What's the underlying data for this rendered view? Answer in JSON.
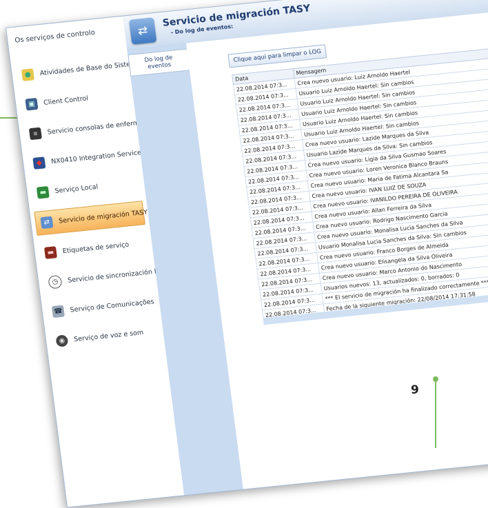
{
  "sidebar": {
    "title": "Os serviços de controlo",
    "items": [
      {
        "label": "Atividades de Base do Sistema",
        "icon": "users-icon"
      },
      {
        "label": "Client Control",
        "icon": "monitor-icon"
      },
      {
        "label": "Servicio consolas de enfermera",
        "icon": "console-icon"
      },
      {
        "label": "NX0410 Integration Service",
        "icon": "integration-icon"
      },
      {
        "label": "Serviço Local",
        "icon": "book-icon"
      },
      {
        "label": "Servicio de migración TASY",
        "icon": "migration-icon"
      },
      {
        "label": "Etiquetas de serviço",
        "icon": "label-icon"
      },
      {
        "label": "Servicio de sincronización horaria",
        "icon": "clock-icon"
      },
      {
        "label": "Serviço de Comunicações",
        "icon": "phone-icon"
      },
      {
        "label": "Serviço de voz e som",
        "icon": "speaker-icon"
      }
    ]
  },
  "header": {
    "title": "Servicio de migración TASY",
    "subtitle": "- Do log de eventos:"
  },
  "tabs": [
    {
      "label": "Do log de eventos"
    }
  ],
  "toolbar": {
    "clear_log_label": "Clique aqui para limpar o LOG"
  },
  "log_table": {
    "columns": [
      "Data",
      "Mensagem"
    ],
    "rows": [
      [
        "22.08.2014 07:3...",
        "Crea nuevo usuario: Luiz Arnoldo Haertel"
      ],
      [
        "22.08.2014 07:3...",
        "Usuario Luiz Arnoldo Haertel: Sin cambios"
      ],
      [
        "22.08.2014 07:3...",
        "Usuario Luiz Arnoldo Haertel: Sin cambios"
      ],
      [
        "22.08.2014 07:3...",
        "Usuario Luiz Arnoldo Haertel: Sin cambios"
      ],
      [
        "22.08.2014 07:3...",
        "Usuario Luiz Arnoldo Haertel: Sin cambios"
      ],
      [
        "22.08.2014 07:3...",
        "Usuario Luiz Arnoldo Haertel: Sin cambios"
      ],
      [
        "22.08.2014 07:3...",
        "Crea nuevo usuario: Lazide Marques da Silva"
      ],
      [
        "22.08.2014 07:3...",
        "Usuario Lazide Marques da Silva: Sin cambios"
      ],
      [
        "22.08.2014 07:3...",
        "Crea nuevo usuario: Ligia da Silva Gusmao Soares"
      ],
      [
        "22.08.2014 07:3...",
        "Crea nuevo usuario: Loren Veronica Blanco Brauns"
      ],
      [
        "22.08.2014 07:3...",
        "Crea nuevo usuario: Maria de Fatima Alcantara Sa"
      ],
      [
        "22.08.2014 07:3...",
        "Crea nuevo usuario: IVAN LUIZ DE SOUZA"
      ],
      [
        "22.08.2014 07:3...",
        "Crea nuevo usuario: IVANILDO PEREIRA DE OLIVEIRA"
      ],
      [
        "22.08.2014 07:3...",
        "Crea nuevo usuario: Allan Ferreira da Silva"
      ],
      [
        "22.08.2014 07:3...",
        "Crea nuevo usuario: Rodrigo Nascimento Garcia"
      ],
      [
        "22.08.2014 07:3...",
        "Crea nuevo usuario: Monalisa Lucia Sanches da Silva"
      ],
      [
        "22.08.2014 07:3...",
        "Usuario Monalisa Lucia Sanches da Silva: Sin cambios"
      ],
      [
        "22.08.2014 07:3...",
        "Crea nuevo usuario: Franco Borges de Almeida"
      ],
      [
        "22.08.2014 07:3...",
        "Crea nuevo usuario: Elisangela da Silva Oliveira"
      ],
      [
        "22.08.2014 07:3...",
        "Crea nuevo usuario: Marco Antonio do Nascimento"
      ],
      [
        "22.08.2014 07:3...",
        "Usuarios nuevos: 13, actualizados: 0, borrados: 0"
      ],
      [
        "22.08.2014 07:3...",
        "*** El servicio de migración ha finalizado correctamente ***"
      ],
      [
        "22.08.2014 07:3...",
        "Fecha de la siguiente migración: 22/08/2014 17:31:58"
      ]
    ]
  },
  "callout": {
    "number": "9"
  },
  "colors": {
    "accent": "#7dbb5c",
    "active_item": "#f7b35a",
    "header_text": "#1f3c70"
  }
}
